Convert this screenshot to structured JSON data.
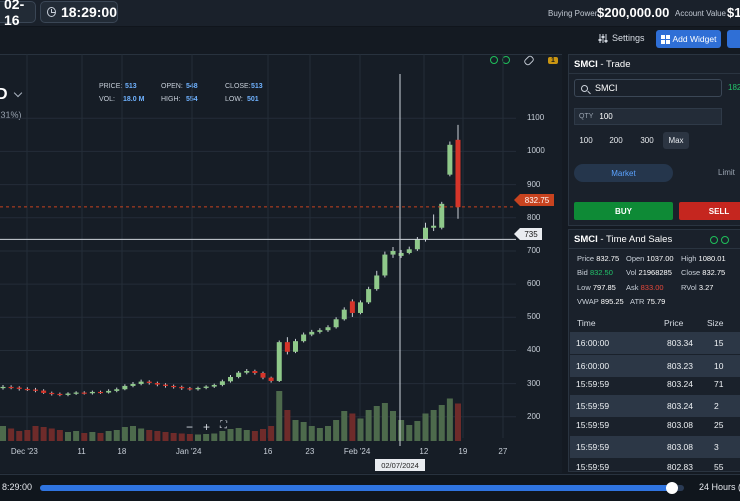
{
  "topbar": {
    "date": "02-16",
    "time": "18:29:00",
    "buying_power_label": "Buying Power",
    "buying_power_value": "$200,000.00",
    "account_value_label": "Account Value",
    "account_value_value": "$1"
  },
  "toolbar": {
    "settings_label": "Settings",
    "add_widget_label": "Add Widget"
  },
  "chart": {
    "symbol_fragment": "D",
    "pct_fragment": ".31%)",
    "tool_badge": "1",
    "ohlc": {
      "price_label": "PRICE:",
      "price": "513",
      "open_label": "OPEN:",
      "open": "548",
      "close_label": "CLOSE:",
      "close": "513",
      "vol_label": "VOL:",
      "vol": "18.0 M",
      "high_label": "HIGH:",
      "high": "554",
      "low_label": "LOW:",
      "low": "501"
    },
    "last_price_tag": "832.75",
    "crosshair_price_tag": "735",
    "crosshair_date_tag": "02/07/2024",
    "zoom": {
      "minus": "−",
      "plus": "+",
      "fit": "⛶"
    }
  },
  "chart_data": {
    "type": "candlestick",
    "ylim": [
      130,
      1140
    ],
    "y_ticks": [
      "200",
      "300",
      "400",
      "500",
      "600",
      "700",
      "800",
      "900",
      "1000",
      "1100"
    ],
    "x_ticks": [
      "Dec '23",
      "11",
      "18",
      "Jan '24",
      "16",
      "23",
      "Feb '24",
      "12",
      "19",
      "27"
    ],
    "candles": [
      {
        "o": 287,
        "c": 290,
        "h": 296,
        "l": 282,
        "v": 0.3
      },
      {
        "o": 290,
        "c": 288,
        "h": 295,
        "l": 283,
        "v": 0.25
      },
      {
        "o": 288,
        "c": 284,
        "h": 292,
        "l": 279,
        "v": 0.2
      },
      {
        "o": 284,
        "c": 282,
        "h": 289,
        "l": 278,
        "v": 0.22
      },
      {
        "o": 282,
        "c": 279,
        "h": 287,
        "l": 274,
        "v": 0.3
      },
      {
        "o": 279,
        "c": 272,
        "h": 283,
        "l": 269,
        "v": 0.28
      },
      {
        "o": 272,
        "c": 269,
        "h": 276,
        "l": 264,
        "v": 0.25
      },
      {
        "o": 269,
        "c": 266,
        "h": 273,
        "l": 262,
        "v": 0.22
      },
      {
        "o": 266,
        "c": 270,
        "h": 274,
        "l": 262,
        "v": 0.18
      },
      {
        "o": 270,
        "c": 273,
        "h": 277,
        "l": 266,
        "v": 0.2
      },
      {
        "o": 273,
        "c": 271,
        "h": 277,
        "l": 267,
        "v": 0.16
      },
      {
        "o": 271,
        "c": 275,
        "h": 279,
        "l": 267,
        "v": 0.18
      },
      {
        "o": 275,
        "c": 273,
        "h": 279,
        "l": 269,
        "v": 0.16
      },
      {
        "o": 273,
        "c": 278,
        "h": 283,
        "l": 270,
        "v": 0.2
      },
      {
        "o": 278,
        "c": 283,
        "h": 288,
        "l": 274,
        "v": 0.22
      },
      {
        "o": 283,
        "c": 293,
        "h": 298,
        "l": 280,
        "v": 0.28
      },
      {
        "o": 293,
        "c": 299,
        "h": 305,
        "l": 289,
        "v": 0.3
      },
      {
        "o": 299,
        "c": 306,
        "h": 312,
        "l": 295,
        "v": 0.25
      },
      {
        "o": 306,
        "c": 302,
        "h": 310,
        "l": 297,
        "v": 0.22
      },
      {
        "o": 302,
        "c": 297,
        "h": 306,
        "l": 292,
        "v": 0.2
      },
      {
        "o": 297,
        "c": 293,
        "h": 301,
        "l": 288,
        "v": 0.18
      },
      {
        "o": 293,
        "c": 290,
        "h": 297,
        "l": 285,
        "v": 0.16
      },
      {
        "o": 290,
        "c": 286,
        "h": 294,
        "l": 281,
        "v": 0.15
      },
      {
        "o": 286,
        "c": 283,
        "h": 290,
        "l": 279,
        "v": 0.14
      },
      {
        "o": 283,
        "c": 287,
        "h": 291,
        "l": 279,
        "v": 0.13
      },
      {
        "o": 287,
        "c": 291,
        "h": 295,
        "l": 283,
        "v": 0.14
      },
      {
        "o": 291,
        "c": 296,
        "h": 300,
        "l": 287,
        "v": 0.15
      },
      {
        "o": 296,
        "c": 307,
        "h": 312,
        "l": 292,
        "v": 0.2
      },
      {
        "o": 307,
        "c": 320,
        "h": 326,
        "l": 303,
        "v": 0.24
      },
      {
        "o": 320,
        "c": 333,
        "h": 338,
        "l": 316,
        "v": 0.26
      },
      {
        "o": 333,
        "c": 338,
        "h": 344,
        "l": 328,
        "v": 0.22
      },
      {
        "o": 338,
        "c": 332,
        "h": 342,
        "l": 327,
        "v": 0.2
      },
      {
        "o": 332,
        "c": 318,
        "h": 336,
        "l": 313,
        "v": 0.24
      },
      {
        "o": 318,
        "c": 308,
        "h": 321,
        "l": 303,
        "v": 0.3
      },
      {
        "o": 308,
        "c": 425,
        "h": 430,
        "l": 305,
        "v": 1.0
      },
      {
        "o": 425,
        "c": 396,
        "h": 440,
        "l": 388,
        "v": 0.62
      },
      {
        "o": 396,
        "c": 428,
        "h": 435,
        "l": 392,
        "v": 0.42
      },
      {
        "o": 428,
        "c": 448,
        "h": 454,
        "l": 424,
        "v": 0.38
      },
      {
        "o": 448,
        "c": 456,
        "h": 462,
        "l": 443,
        "v": 0.3
      },
      {
        "o": 456,
        "c": 461,
        "h": 467,
        "l": 451,
        "v": 0.26
      },
      {
        "o": 461,
        "c": 470,
        "h": 476,
        "l": 456,
        "v": 0.3
      },
      {
        "o": 470,
        "c": 494,
        "h": 500,
        "l": 466,
        "v": 0.42
      },
      {
        "o": 494,
        "c": 523,
        "h": 530,
        "l": 490,
        "v": 0.6
      },
      {
        "o": 548,
        "c": 513,
        "h": 554,
        "l": 501,
        "v": 0.55
      },
      {
        "o": 513,
        "c": 545,
        "h": 551,
        "l": 509,
        "v": 0.45
      },
      {
        "o": 545,
        "c": 585,
        "h": 592,
        "l": 540,
        "v": 0.62
      },
      {
        "o": 585,
        "c": 626,
        "h": 640,
        "l": 580,
        "v": 0.7
      },
      {
        "o": 626,
        "c": 689,
        "h": 698,
        "l": 620,
        "v": 0.76
      },
      {
        "o": 689,
        "c": 700,
        "h": 712,
        "l": 679,
        "v": 0.6
      },
      {
        "o": 685,
        "c": 694,
        "h": 703,
        "l": 679,
        "v": 0.42
      },
      {
        "o": 694,
        "c": 705,
        "h": 713,
        "l": 690,
        "v": 0.32
      },
      {
        "o": 705,
        "c": 735,
        "h": 742,
        "l": 700,
        "v": 0.4
      },
      {
        "o": 735,
        "c": 770,
        "h": 785,
        "l": 728,
        "v": 0.55
      },
      {
        "o": 770,
        "c": 776,
        "h": 810,
        "l": 760,
        "v": 0.62
      },
      {
        "o": 770,
        "c": 842,
        "h": 848,
        "l": 765,
        "v": 0.72
      },
      {
        "o": 930,
        "c": 1020,
        "h": 1030,
        "l": 925,
        "v": 0.85
      },
      {
        "o": 1035,
        "c": 832,
        "h": 1080,
        "l": 797,
        "v": 0.75
      }
    ]
  },
  "trade": {
    "title_symbol": "SMCI",
    "title_suffix": " - Trade",
    "symbol_value": "SMCI",
    "side_price": "182",
    "qty_label": "QTY",
    "qty_value": "100",
    "qty_presets": [
      "100",
      "200",
      "300",
      "Max"
    ],
    "market_tab": "Market",
    "limit_tab": "Limit",
    "buy_label": "BUY",
    "sell_label": "SELL"
  },
  "tas": {
    "title_symbol": "SMCI",
    "title_suffix": " - Time And Sales",
    "stats": {
      "price_l": "Price",
      "price": "832.75",
      "open_l": "Open",
      "open": "1037.00",
      "high_l": "High",
      "high": "1080.01",
      "bid_l": "Bid",
      "bid": "832.50",
      "vol_l": "Vol",
      "vol": "21968285",
      "close_l": "Close",
      "close": "832.75",
      "low_l": "Low",
      "low": "797.85",
      "ask_l": "Ask",
      "ask": "833.00",
      "rvol_l": "RVol",
      "rvol": "3.27",
      "vwap_l": "VWAP",
      "vwap": "895.25",
      "atr_l": "ATR",
      "atr": "75.79"
    },
    "headers": {
      "time": "Time",
      "price": "Price",
      "size": "Size"
    },
    "rows": [
      {
        "time": "16:00:00",
        "price": "803.34",
        "size": "15"
      },
      {
        "time": "16:00:00",
        "price": "803.23",
        "size": "10"
      },
      {
        "time": "15:59:59",
        "price": "803.24",
        "size": "71"
      },
      {
        "time": "15:59:59",
        "price": "803.24",
        "size": "2"
      },
      {
        "time": "15:59:59",
        "price": "803.08",
        "size": "25"
      },
      {
        "time": "15:59:59",
        "price": "803.08",
        "size": "3"
      },
      {
        "time": "15:59:59",
        "price": "802.83",
        "size": "55"
      }
    ]
  },
  "bottombar": {
    "time": "8:29:00",
    "range": "24 Hours (",
    "progress": 0.98
  },
  "colors": {
    "up": "#8fc98a",
    "down": "#d6352a",
    "accent": "#2f74e0"
  }
}
